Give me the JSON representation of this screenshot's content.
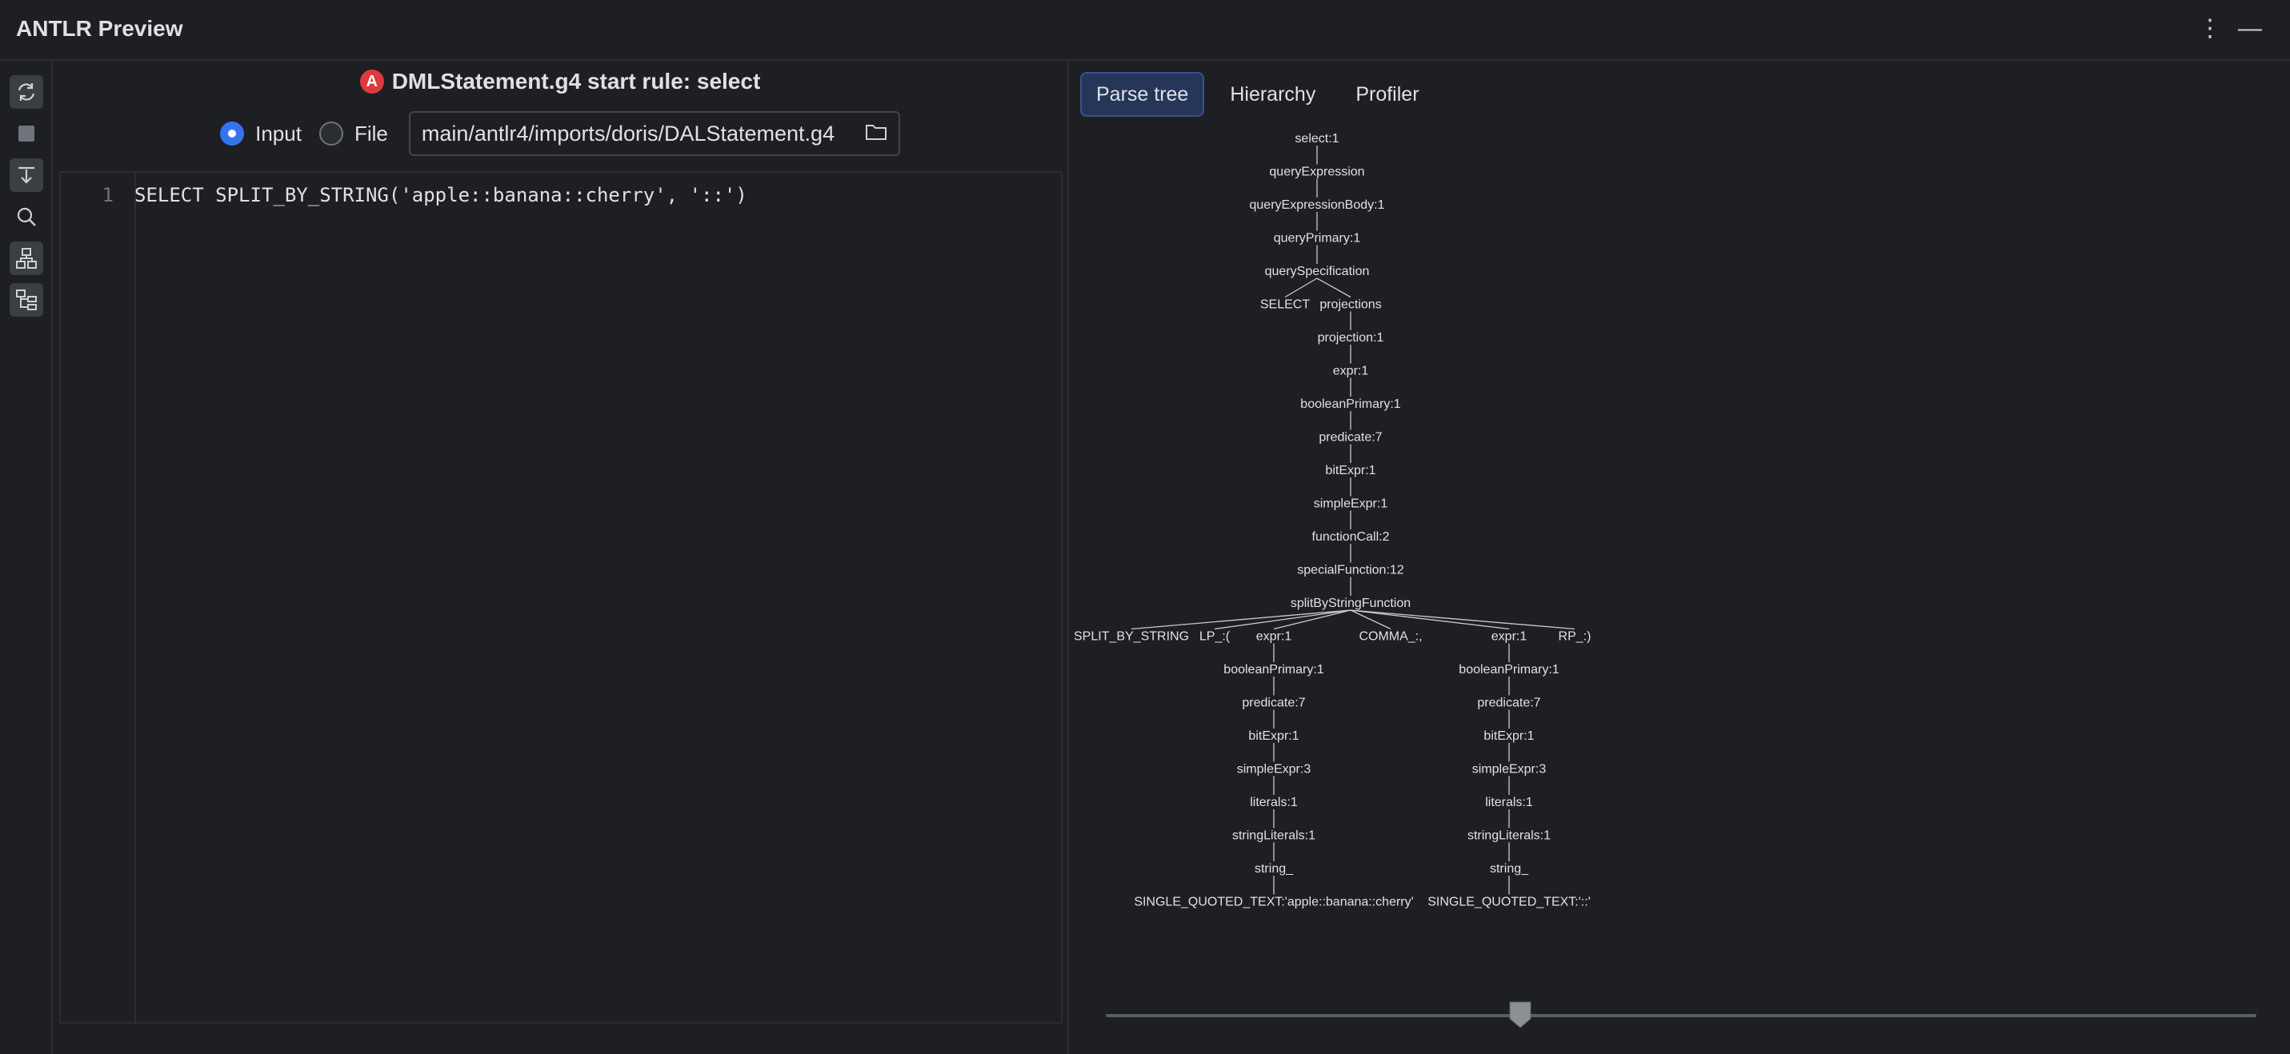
{
  "window": {
    "title": "ANTLR Preview",
    "more_glyph": "⋮",
    "minimize_glyph": "—"
  },
  "toolbar": {
    "icons": [
      "refresh-icon",
      "stop-icon",
      "export-icon",
      "search-icon",
      "hierarchy-icon",
      "tree-icon"
    ]
  },
  "grammar": {
    "badge": "A",
    "label": "DMLStatement.g4 start rule: select"
  },
  "source": {
    "input_label": "Input",
    "file_label": "File",
    "selected": "Input",
    "file_path": "main/antlr4/imports/doris/DALStatement.g4"
  },
  "editor": {
    "line_number": "1",
    "code": "SELECT SPLIT_BY_STRING('apple::banana::cherry', '::')"
  },
  "tabs": [
    {
      "label": "Parse tree",
      "active": true
    },
    {
      "label": "Hierarchy",
      "active": false
    },
    {
      "label": "Profiler",
      "active": false
    }
  ],
  "parse_tree": {
    "trunk": [
      "select:1",
      "queryExpression",
      "queryExpressionBody:1",
      "queryPrimary:1",
      "querySpecification"
    ],
    "spec_children": [
      "SELECT",
      "projections"
    ],
    "projection_chain": [
      "projection:1",
      "expr:1",
      "booleanPrimary:1",
      "predicate:7",
      "bitExpr:1",
      "simpleExpr:1",
      "functionCall:2",
      "specialFunction:12",
      "splitByStringFunction"
    ],
    "function_children": [
      "SPLIT_BY_STRING",
      "LP_:(",
      "expr:1",
      "COMMA_:,",
      "expr:1",
      "RP_:)"
    ],
    "arg1_chain": [
      "booleanPrimary:1",
      "predicate:7",
      "bitExpr:1",
      "simpleExpr:3",
      "literals:1",
      "stringLiterals:1",
      "string_",
      "SINGLE_QUOTED_TEXT:'apple::banana::cherry'"
    ],
    "arg2_chain": [
      "booleanPrimary:1",
      "predicate:7",
      "bitExpr:1",
      "simpleExpr:3",
      "literals:1",
      "stringLiterals:1",
      "string_",
      "SINGLE_QUOTED_TEXT:'::'"
    ]
  },
  "zoom_slider": {
    "value_fraction": 0.36
  },
  "colors": {
    "background": "#1e1f22",
    "accent": "#3574f0",
    "badge": "#e0393e",
    "active_tab": "#253658"
  }
}
